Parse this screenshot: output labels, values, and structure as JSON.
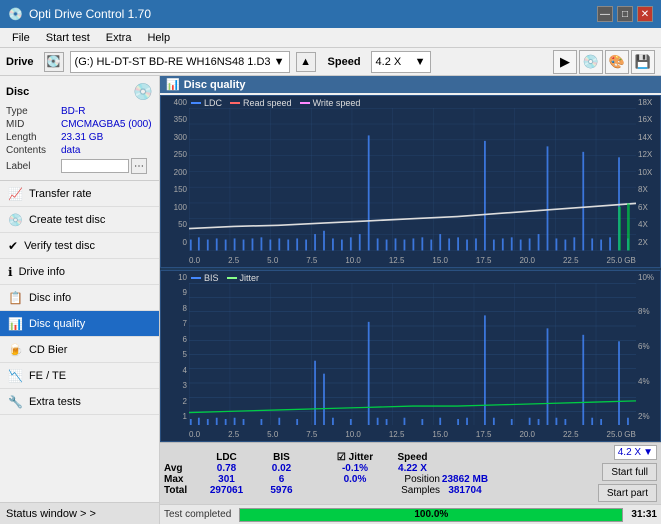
{
  "app": {
    "title": "Opti Drive Control 1.70",
    "icon": "💿"
  },
  "titlebar": {
    "minimize": "—",
    "maximize": "□",
    "close": "✕"
  },
  "menubar": {
    "items": [
      "File",
      "Start test",
      "Extra",
      "Help"
    ]
  },
  "drivebar": {
    "drive_label": "Drive",
    "drive_value": "(G:)  HL-DT-ST BD-RE  WH16NS48 1.D3",
    "speed_label": "Speed",
    "speed_value": "4.2 X"
  },
  "sidebar": {
    "disc_title": "Disc",
    "disc_fields": [
      {
        "key": "Type",
        "value": "BD-R"
      },
      {
        "key": "MID",
        "value": "CMCMAGBA5 (000)"
      },
      {
        "key": "Length",
        "value": "23.31 GB"
      },
      {
        "key": "Contents",
        "value": "data"
      }
    ],
    "label_placeholder": "",
    "nav_items": [
      {
        "id": "transfer-rate",
        "label": "Transfer rate",
        "icon": "📈"
      },
      {
        "id": "create-test-disc",
        "label": "Create test disc",
        "icon": "💿"
      },
      {
        "id": "verify-test-disc",
        "label": "Verify test disc",
        "icon": "✔"
      },
      {
        "id": "drive-info",
        "label": "Drive info",
        "icon": "ℹ"
      },
      {
        "id": "disc-info",
        "label": "Disc info",
        "icon": "📋"
      },
      {
        "id": "disc-quality",
        "label": "Disc quality",
        "icon": "📊",
        "active": true
      },
      {
        "id": "cd-bier",
        "label": "CD Bier",
        "icon": "🍺"
      },
      {
        "id": "fe-te",
        "label": "FE / TE",
        "icon": "📉"
      },
      {
        "id": "extra-tests",
        "label": "Extra tests",
        "icon": "🔧"
      }
    ],
    "status_window": "Status window > >"
  },
  "disc_quality": {
    "title": "Disc quality",
    "legend": {
      "ldc": "LDC",
      "read_speed": "Read speed",
      "write_speed": "Write speed",
      "bis": "BIS",
      "jitter": "Jitter"
    }
  },
  "chart1": {
    "y_axis_left": [
      "400",
      "350",
      "300",
      "250",
      "200",
      "150",
      "100",
      "50",
      "0"
    ],
    "y_axis_right": [
      "18X",
      "16X",
      "14X",
      "12X",
      "10X",
      "8X",
      "6X",
      "4X",
      "2X"
    ],
    "x_axis": [
      "0.0",
      "2.5",
      "5.0",
      "7.5",
      "10.0",
      "12.5",
      "15.0",
      "17.5",
      "20.0",
      "22.5",
      "25.0 GB"
    ]
  },
  "chart2": {
    "y_axis_left": [
      "10",
      "9",
      "8",
      "7",
      "6",
      "5",
      "4",
      "3",
      "2",
      "1"
    ],
    "y_axis_right": [
      "10%",
      "8%",
      "6%",
      "4%",
      "2%"
    ],
    "x_axis": [
      "0.0",
      "2.5",
      "5.0",
      "7.5",
      "10.0",
      "12.5",
      "15.0",
      "17.5",
      "20.0",
      "22.5",
      "25.0 GB"
    ]
  },
  "stats": {
    "headers": [
      "",
      "LDC",
      "BIS",
      "",
      "Jitter",
      "Speed",
      ""
    ],
    "rows": [
      {
        "label": "Avg",
        "ldc": "0.78",
        "bis": "0.02",
        "jitter": "-0.1%",
        "speed": "4.22 X"
      },
      {
        "label": "Max",
        "ldc": "301",
        "bis": "6",
        "jitter": "0.0%",
        "position": "23862 MB"
      },
      {
        "label": "Total",
        "ldc": "297061",
        "bis": "5976",
        "samples": "381704"
      }
    ],
    "jitter_checked": true,
    "speed_dropdown": "4.2 X",
    "start_full": "Start full",
    "start_part": "Start part"
  },
  "progress": {
    "status": "Test completed",
    "percent": 100,
    "percent_text": "100.0%",
    "time": "31:31"
  }
}
